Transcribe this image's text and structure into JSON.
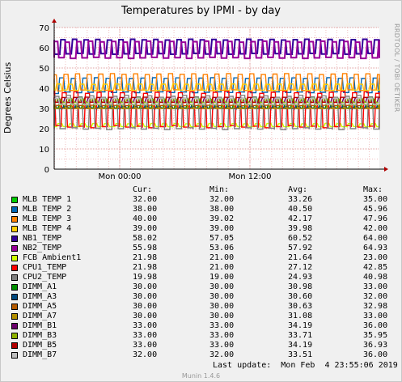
{
  "chart_data": {
    "type": "line",
    "title": "Temperatures by IPMI - by day",
    "ylabel": "Degrees Celsius",
    "xlabel": "",
    "ylim": [
      0,
      70
    ],
    "yticks": [
      0,
      10,
      20,
      30,
      40,
      50,
      60,
      70
    ],
    "xtick_labels": [
      "Mon 00:00",
      "Mon 12:00"
    ],
    "grid": true,
    "legend_headers": {
      "cur": "Cur:",
      "min": "Min:",
      "avg": "Avg:",
      "max": "Max:"
    },
    "series": [
      {
        "name": "MLB TEMP 1",
        "color": "#00cc00",
        "cur": "32.00",
        "min": "32.00",
        "avg": "33.26",
        "max": "35.00",
        "low": 32,
        "high": 35
      },
      {
        "name": "MLB TEMP 2",
        "color": "#0066b3",
        "cur": "38.00",
        "min": "38.00",
        "avg": "40.50",
        "max": "45.96",
        "low": 38,
        "high": 45
      },
      {
        "name": "MLB TEMP 3",
        "color": "#ff8000",
        "cur": "40.00",
        "min": "39.02",
        "avg": "42.17",
        "max": "47.96",
        "low": 39,
        "high": 47
      },
      {
        "name": "MLB TEMP 4",
        "color": "#ffcc00",
        "cur": "39.00",
        "min": "39.00",
        "avg": "39.98",
        "max": "42.00",
        "low": 39,
        "high": 42
      },
      {
        "name": "NB1_TEMP",
        "color": "#330099",
        "cur": "58.02",
        "min": "57.05",
        "avg": "60.52",
        "max": "64.00",
        "low": 57,
        "high": 64
      },
      {
        "name": "NB2_TEMP",
        "color": "#990099",
        "cur": "55.98",
        "min": "53.06",
        "avg": "57.92",
        "max": "64.93",
        "low": 55,
        "high": 63
      },
      {
        "name": "FCB Ambient1",
        "color": "#ccff00",
        "cur": "21.98",
        "min": "21.00",
        "avg": "21.64",
        "max": "23.00",
        "low": 21,
        "high": 22.5
      },
      {
        "name": "CPU1_TEMP",
        "color": "#ff0000",
        "cur": "21.98",
        "min": "21.00",
        "avg": "27.12",
        "max": "42.85",
        "low": 21,
        "high": 38
      },
      {
        "name": "CPU2_TEMP",
        "color": "#808080",
        "cur": "19.98",
        "min": "19.00",
        "avg": "24.93",
        "max": "40.98",
        "low": 20,
        "high": 36
      },
      {
        "name": "DIMM_A1",
        "color": "#008f00",
        "cur": "30.00",
        "min": "30.00",
        "avg": "30.98",
        "max": "33.00",
        "low": 30,
        "high": 32
      },
      {
        "name": "DIMM_A3",
        "color": "#00487d",
        "cur": "30.00",
        "min": "30.00",
        "avg": "30.60",
        "max": "32.00",
        "low": 30,
        "high": 31
      },
      {
        "name": "DIMM_A5",
        "color": "#b35a00",
        "cur": "30.00",
        "min": "30.00",
        "avg": "30.63",
        "max": "32.98",
        "low": 30,
        "high": 31.5
      },
      {
        "name": "DIMM_A7",
        "color": "#b38f00",
        "cur": "30.00",
        "min": "30.00",
        "avg": "31.08",
        "max": "33.00",
        "low": 30,
        "high": 32
      },
      {
        "name": "DIMM_B1",
        "color": "#6b006b",
        "cur": "33.00",
        "min": "33.00",
        "avg": "34.19",
        "max": "36.00",
        "low": 33,
        "high": 35
      },
      {
        "name": "DIMM_B3",
        "color": "#8fb300",
        "cur": "33.00",
        "min": "33.00",
        "avg": "33.71",
        "max": "35.95",
        "low": 33,
        "high": 34.5
      },
      {
        "name": "DIMM_B5",
        "color": "#b30000",
        "cur": "33.00",
        "min": "33.00",
        "avg": "34.19",
        "max": "36.93",
        "low": 33,
        "high": 35.5
      },
      {
        "name": "DIMM_B7",
        "color": "#bebebe",
        "cur": "32.00",
        "min": "32.00",
        "avg": "33.51",
        "max": "36.00",
        "low": 32,
        "high": 35
      }
    ]
  },
  "last_update": "Last update:  Mon Feb  4 23:55:06 2019",
  "footer_version": "Munin 1.4.6",
  "watermark": "RRDTOOL / TOBI OETIKER"
}
